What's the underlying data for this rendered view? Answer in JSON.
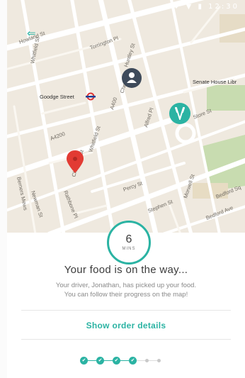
{
  "status_bar": {
    "icons": "♥ ▼ ▮ 12:30"
  },
  "map": {
    "roads": {
      "howland": "Howland St",
      "whitfield": "Whitfield St",
      "torrington": "Torrington Pl",
      "huntley": "Huntley St",
      "chenies": "Chenies St",
      "alfred": "Alfred Pl",
      "store": "Store St",
      "a400": "A400",
      "a4200": "A4200",
      "whitfield2": "Whitfield St",
      "charlotte": "Charlotte St",
      "rathbone": "Rathbone Pl",
      "percy": "Percy St",
      "newman": "Newman St",
      "berners": "Berners Mews",
      "morwell": "Morwell St",
      "bedford_ave": "Bedford Ave",
      "bedford_sq": "Bedford Sq",
      "stephen": "Stephen St"
    },
    "places": {
      "goodge": "Goodge Street",
      "senate": "Senate House Libr"
    }
  },
  "timer": {
    "value": "6",
    "unit": "MINS"
  },
  "headline": "Your food is on the way...",
  "description": {
    "line1": "Your driver, Jonathan, has picked up your food.",
    "line2": "You can follow their progress on the map!"
  },
  "order_link": "Show order details",
  "progress": {
    "completed": 4,
    "total": 6
  },
  "colors": {
    "accent": "#2bb3a3",
    "pin": "#e23b33",
    "driver": "#3e4a5a"
  }
}
